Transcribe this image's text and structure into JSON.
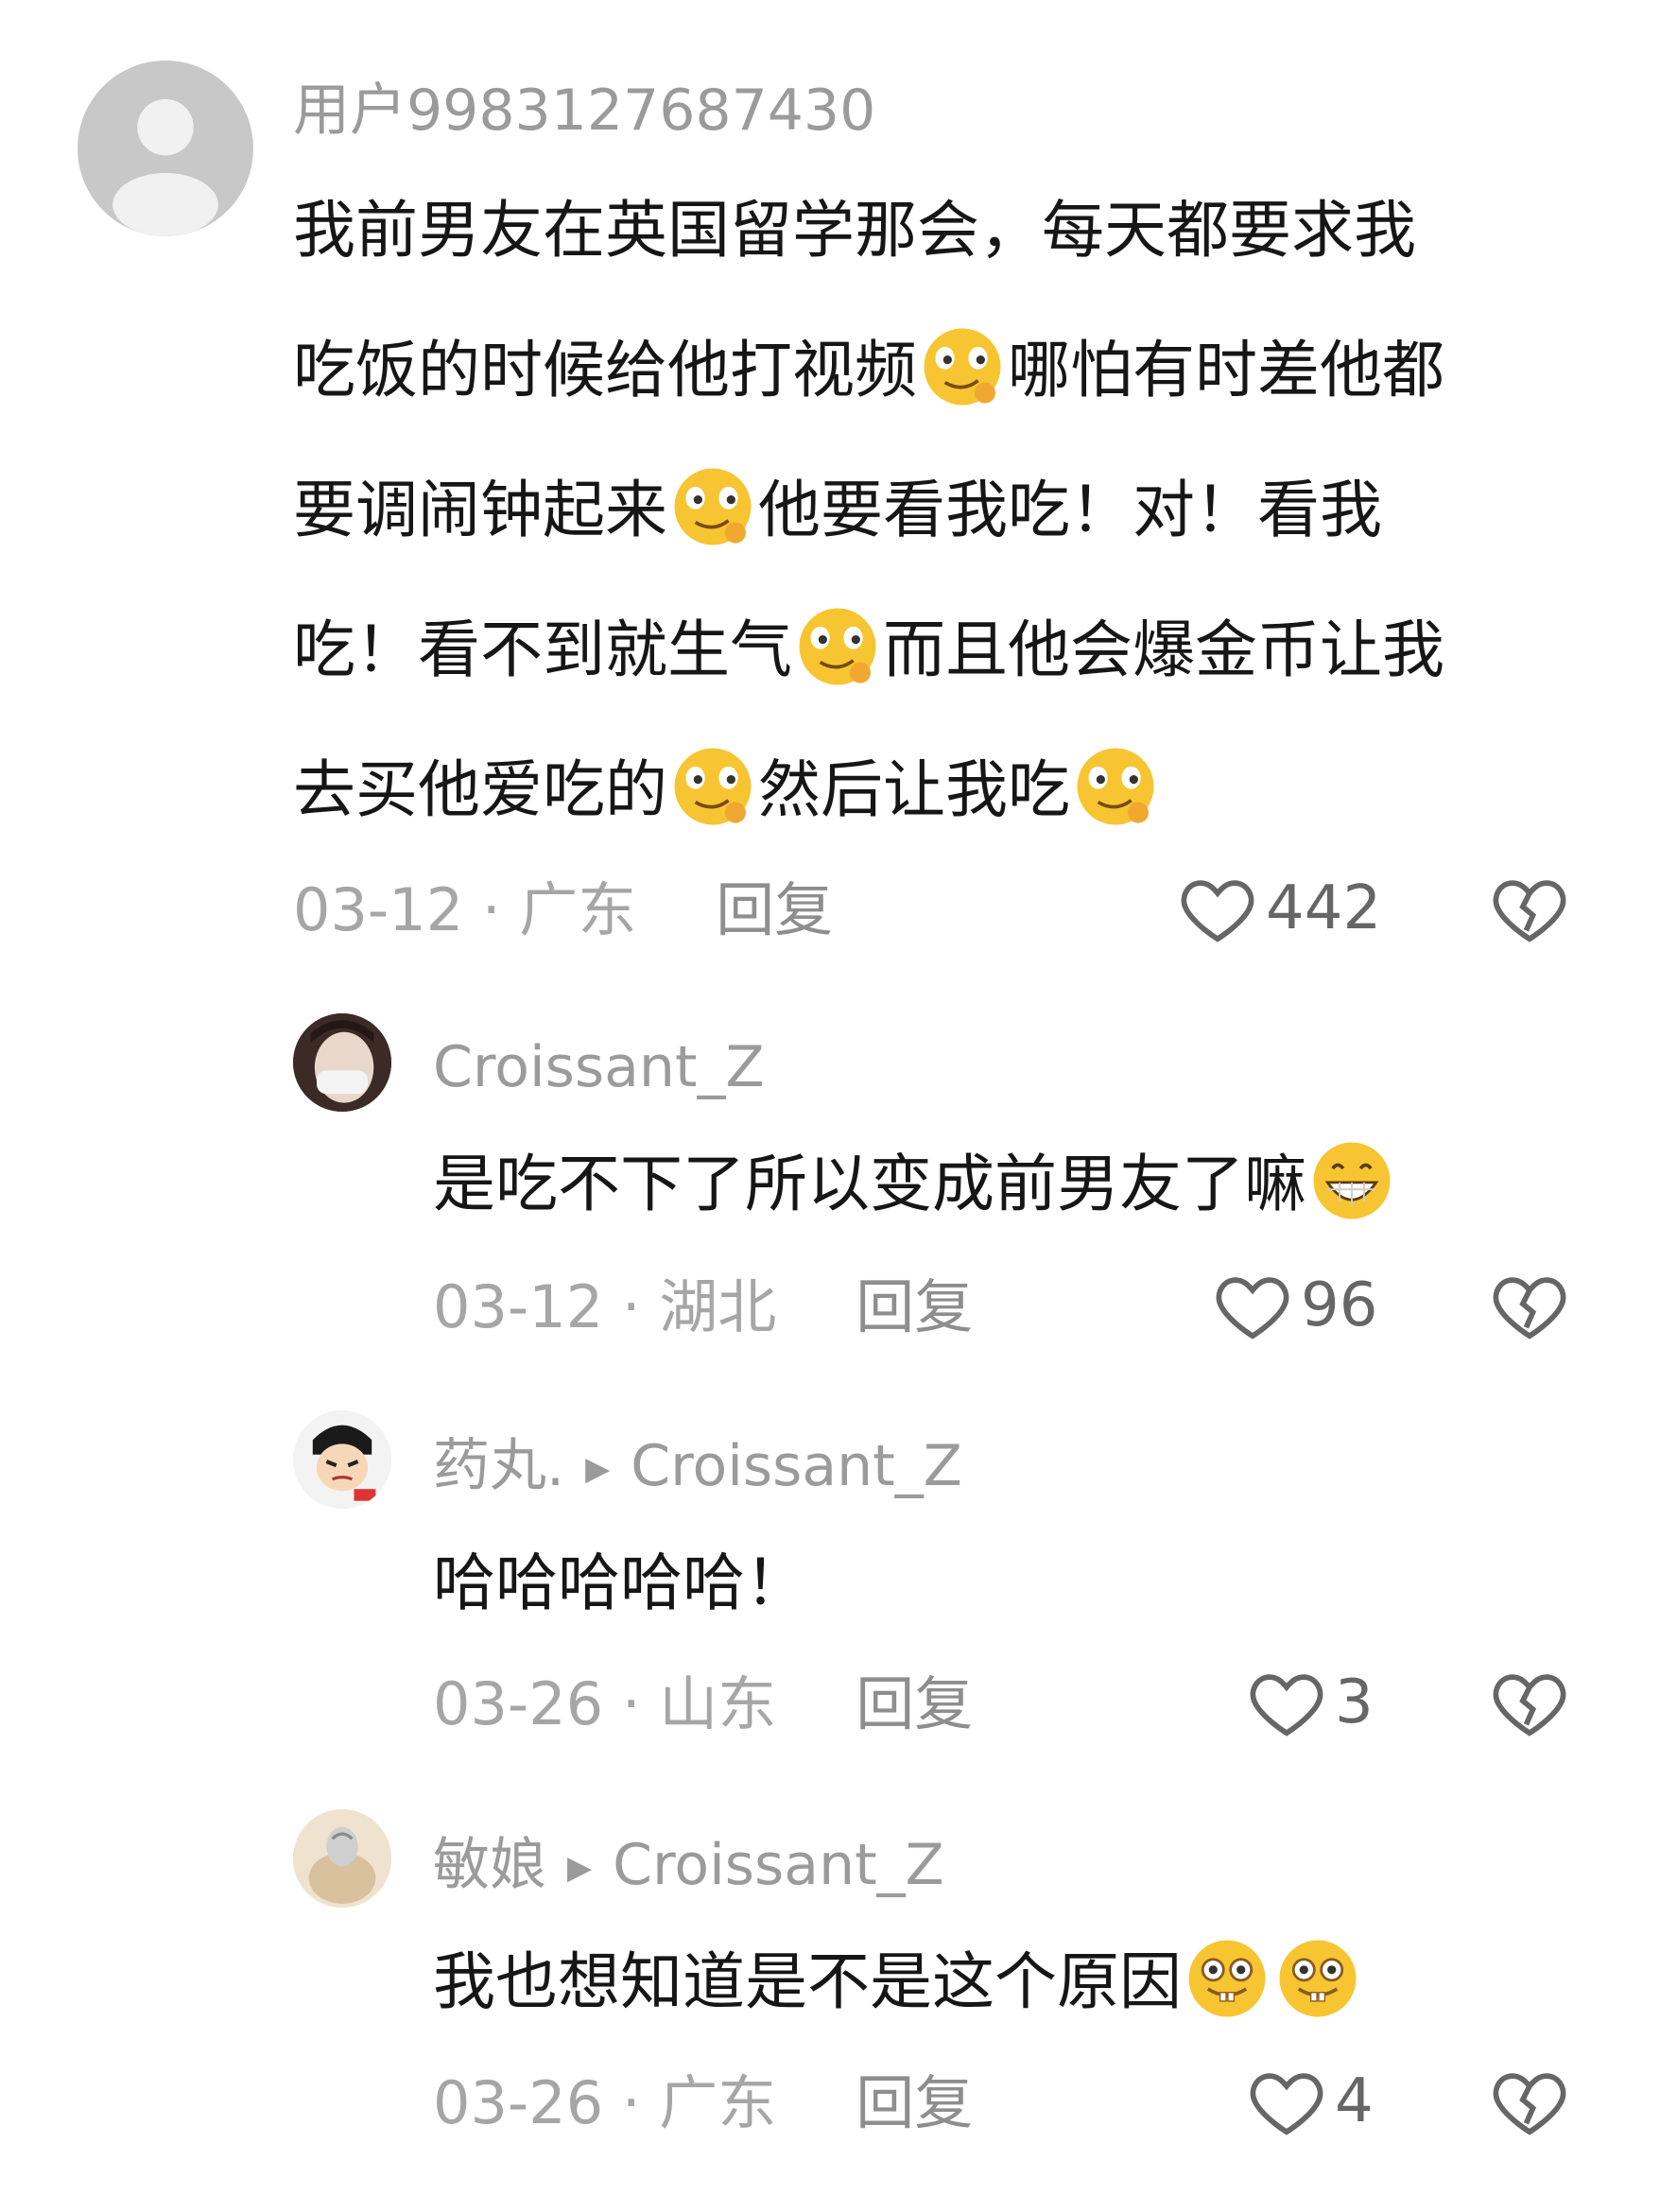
{
  "comments": [
    {
      "username": "用户9983127687430",
      "text_lines": [
        [
          "我前男友在英国留学那会，每天都要求我"
        ],
        [
          "吃饭的时候给他打视频",
          "emoji",
          "哪怕有时差他都"
        ],
        [
          "要调闹钟起来",
          "emoji",
          "他要看我吃！对！看我"
        ],
        [
          "吃！看不到就生气",
          "emoji",
          "而且他会爆金币让我"
        ],
        [
          "去买他爱吃的",
          "emoji",
          "然后让我吃",
          "emoji"
        ]
      ],
      "date_location": "03-12 · 广东",
      "reply_label": "回复",
      "likes": "442"
    },
    {
      "username": "Croissant_Z",
      "reply_to": "",
      "text": "是吃不下了所以变成前男友了嘛",
      "date_location": "03-12 · 湖北",
      "reply_label": "回复",
      "likes": "96"
    },
    {
      "username": "药丸.",
      "reply_to": "Croissant_Z",
      "text": "哈哈哈哈哈！",
      "date_location": "03-26 · 山东",
      "reply_label": "回复",
      "likes": "3"
    },
    {
      "username": "敏娘",
      "reply_to": "Croissant_Z",
      "text": "我也想知道是不是这个原因",
      "date_location": "03-26 · 广东",
      "reply_label": "回复",
      "likes": "4"
    }
  ],
  "icons": {
    "like": "heart-outline-icon",
    "dislike": "broken-heart-icon",
    "emoji_wink": "wink-emoji-icon",
    "emoji_grin": "grin-emoji-icon",
    "emoji_teeth": "teeth-emoji-icon"
  },
  "colors": {
    "text": "#161616",
    "secondary": "#9b9b9b",
    "emoji_yellow": "#f7c531"
  }
}
